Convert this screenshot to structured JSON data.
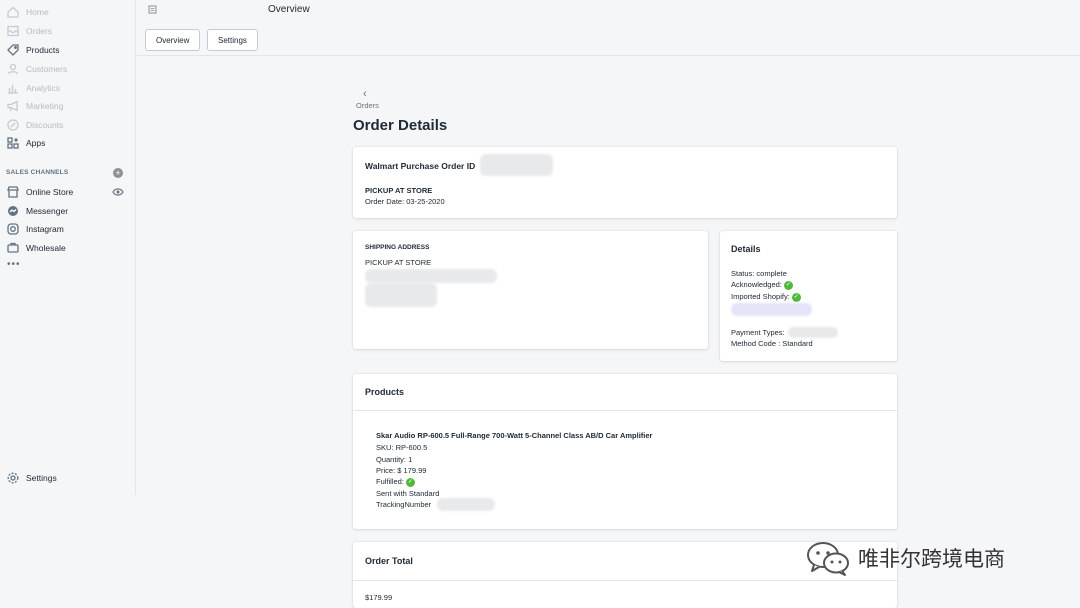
{
  "sidebar": {
    "items": [
      {
        "label": "Home",
        "icon": "home-icon",
        "dim": true
      },
      {
        "label": "Orders",
        "icon": "orders-icon",
        "dim": true
      },
      {
        "label": "Products",
        "icon": "tag-icon",
        "dim": false
      },
      {
        "label": "Customers",
        "icon": "person-icon",
        "dim": true
      },
      {
        "label": "Analytics",
        "icon": "bar-chart-icon",
        "dim": true
      },
      {
        "label": "Marketing",
        "icon": "megaphone-icon",
        "dim": true
      },
      {
        "label": "Discounts",
        "icon": "discount-icon",
        "dim": true
      },
      {
        "label": "Apps",
        "icon": "apps-icon",
        "dim": false
      }
    ],
    "sales_channels_title": "SALES CHANNELS",
    "channels": [
      {
        "label": "Online Store",
        "icon": "store-icon"
      },
      {
        "label": "Messenger",
        "icon": "messenger-icon"
      },
      {
        "label": "Instagram",
        "icon": "instagram-icon"
      },
      {
        "label": "Wholesale",
        "icon": "wholesale-icon"
      }
    ],
    "more": "•••",
    "settings_label": "Settings"
  },
  "topbar": {
    "title": "Overview",
    "tabs": [
      "Overview",
      "Settings"
    ]
  },
  "page": {
    "back_label": "Orders",
    "back_arrow": "‹",
    "title": "Order Details"
  },
  "order_card": {
    "po_label": "Walmart Purchase Order ID",
    "fulfillment": "PICKUP AT STORE",
    "order_date": "Order Date: 03-25-2020"
  },
  "shipping_card": {
    "title": "SHIPPING ADDRESS",
    "line1": "PICKUP AT STORE"
  },
  "details_card": {
    "title": "Details",
    "status": "Status: complete",
    "acknowledged": "Acknowledged:",
    "imported": "Imported Shopify:",
    "payment_types": "Payment Types:",
    "method_code": "Method Code : Standard"
  },
  "products_card": {
    "title": "Products",
    "product_name": "Skar Audio RP-600.5 Full-Range 700-Watt 5-Channel Class AB/D Car Amplifier",
    "sku": "SKU: RP-600.5",
    "quantity": "Quantity: 1",
    "price": "Price: $ 179.99",
    "fulfilled": "Fulfilled:",
    "sent_with": "Sent with Standard",
    "tracking": "TrackingNumber"
  },
  "total_card": {
    "title": "Order Total",
    "amount": "$179.99"
  },
  "watermark": {
    "text": "唯非尔跨境电商"
  },
  "colors": {
    "check_green": "#50b83c",
    "background": "#f4f6f8"
  }
}
